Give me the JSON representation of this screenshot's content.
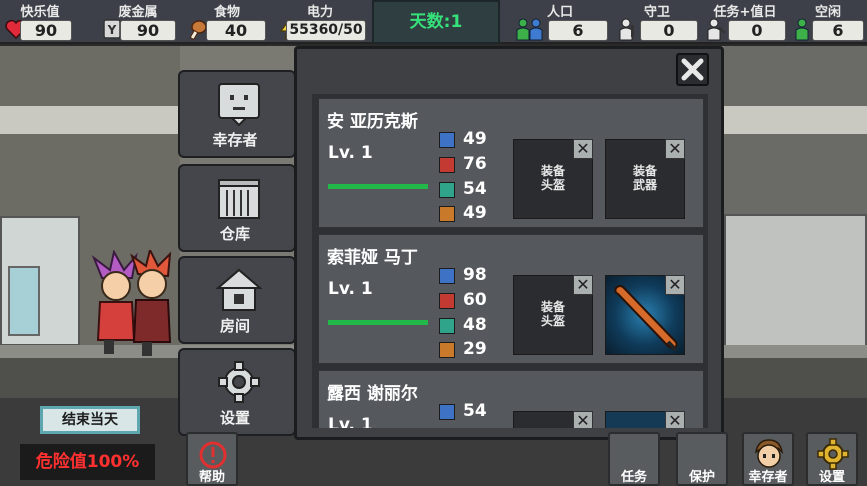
{
  "status": {
    "happiness": {
      "label": "快乐值",
      "value": "90"
    },
    "scrap": {
      "label": "废金属",
      "value": "90"
    },
    "food": {
      "label": "食物",
      "value": "40"
    },
    "power": {
      "label": "电力",
      "value": "55360/50"
    },
    "day": "天数:1",
    "population": {
      "label": "人口",
      "value": "6"
    },
    "guard": {
      "label": "守卫",
      "value": "0"
    },
    "task": {
      "label": "任务+值日",
      "value": "0"
    },
    "idle": {
      "label": "空闲",
      "value": "6"
    }
  },
  "nav": {
    "survivors": "幸存者",
    "warehouse": "仓库",
    "room": "房间",
    "settings": "设置"
  },
  "survivors": [
    {
      "name": "安 亚历克斯",
      "level": "Lv. 1",
      "hp": 1.0,
      "attrs": [
        "49",
        "76",
        "54",
        "49"
      ],
      "helmet_slot": "装备\n头盔",
      "weapon_slot": "装备\n武器",
      "weapon_equipped": false
    },
    {
      "name": "索菲娅 马丁",
      "level": "Lv. 1",
      "hp": 1.0,
      "attrs": [
        "98",
        "60",
        "48",
        "29"
      ],
      "helmet_slot": "装备\n头盔",
      "weapon_equipped": true
    },
    {
      "name": "露西 谢丽尔",
      "level": "Lv. 1",
      "attrs": [
        "54"
      ]
    }
  ],
  "attr_colors": [
    "#3d72c4",
    "#c23a32",
    "#2fa48a",
    "#c9792a"
  ],
  "slot_close": "✕",
  "bottom": {
    "end_day": "结束当天",
    "danger": "危险值100%",
    "help": "帮助",
    "task": "任务",
    "protect": "保护",
    "survivor": "幸存者",
    "settings": "设置"
  }
}
